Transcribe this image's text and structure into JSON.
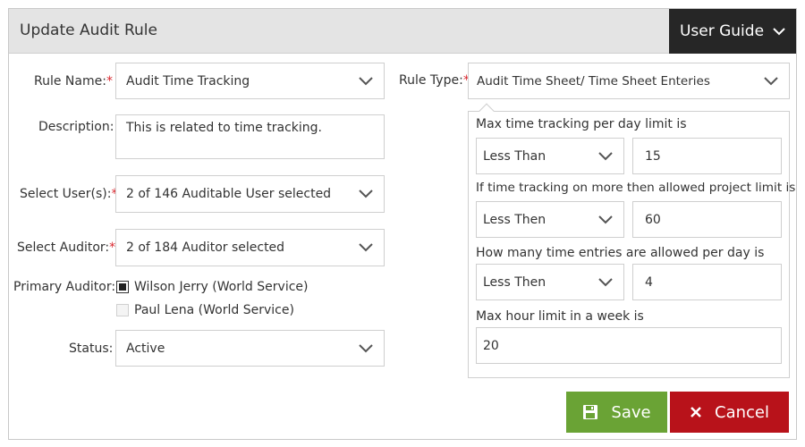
{
  "dialog": {
    "title": "Update Audit Rule",
    "guide_button": "User Guide"
  },
  "form": {
    "rule_name": {
      "label": "Rule Name:",
      "required_mark": "*",
      "value": "Audit Time Tracking"
    },
    "description": {
      "label": "Description:",
      "value": "This is related to time tracking."
    },
    "users": {
      "label": "Select User(s):",
      "required_mark": "*",
      "value": "2 of 146 Auditable User selected"
    },
    "auditor": {
      "label": "Select Auditor:",
      "required_mark": "*",
      "value": "2 of 184 Auditor selected"
    },
    "primary_auditor": {
      "label": "Primary Auditor:",
      "options": [
        {
          "text": "Wilson Jerry (World Service)",
          "checked": true
        },
        {
          "text": "Paul Lena (World Service)",
          "checked": false
        }
      ]
    },
    "status": {
      "label": "Status:",
      "value": "Active"
    },
    "rule_type": {
      "label": "Rule Type:",
      "required_mark": "*",
      "value": "Audit Time Sheet/ Time Sheet Enteries"
    }
  },
  "rule_settings": [
    {
      "question": "Max time tracking per day limit is",
      "operator": "Less Than",
      "value": "15"
    },
    {
      "question": "If time tracking on more then allowed project limit is",
      "operator": "Less Then",
      "value": "60"
    },
    {
      "question": "How many time entries are allowed per day is",
      "operator": "Less Then",
      "value": "4"
    },
    {
      "question": "Max hour limit in a week is",
      "value": "20"
    }
  ],
  "actions": {
    "save": "Save",
    "cancel": "Cancel"
  },
  "colors": {
    "save": "#6aa335",
    "cancel": "#b8121a",
    "guide": "#262626",
    "required": "#d9282f"
  }
}
